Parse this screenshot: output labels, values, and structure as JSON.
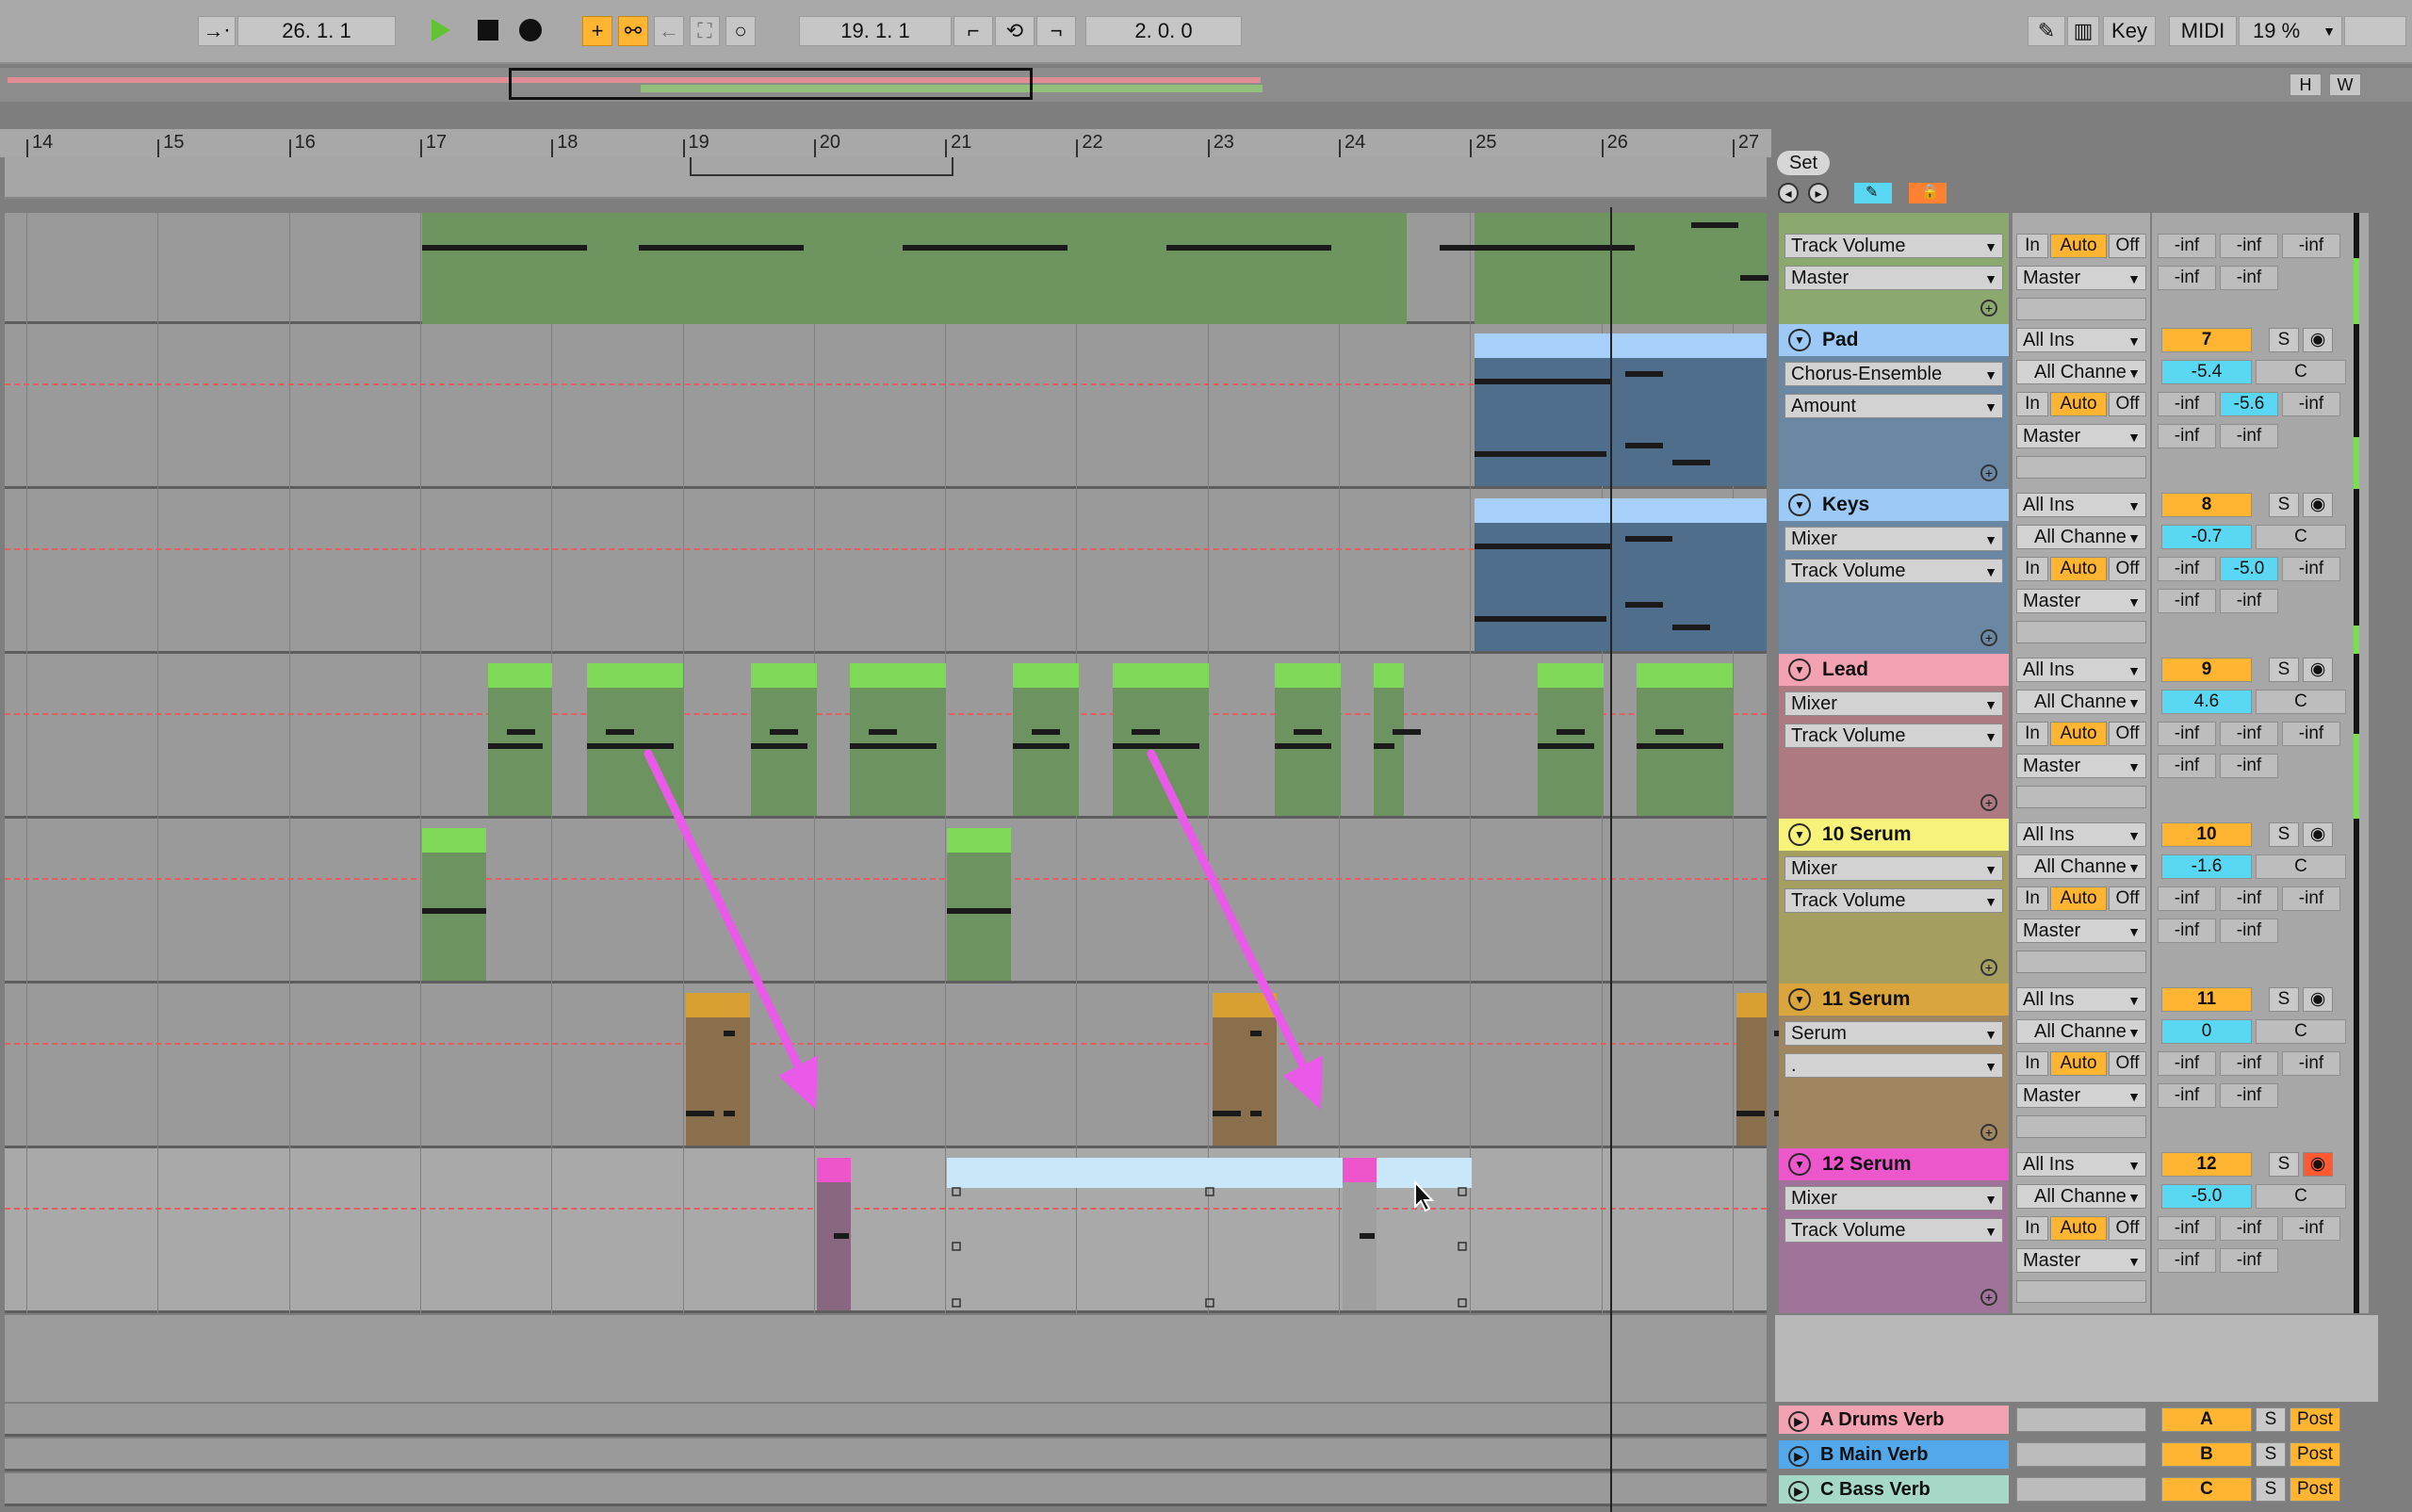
{
  "transport": {
    "follow_glyph": "→⋅",
    "arrangement_position": "26.  1.  1",
    "loop_start": "19.  1.  1",
    "loop_length": "2.  0.  0"
  },
  "right_toolbar": {
    "key_label": "Key",
    "midi_label": "MIDI",
    "zoom": "19 %"
  },
  "overview": {
    "h_label": "H",
    "w_label": "W"
  },
  "ruler": {
    "bars": [
      "14",
      "15",
      "16",
      "17",
      "18",
      "19",
      "20",
      "21",
      "22",
      "23",
      "24",
      "25",
      "26",
      "27"
    ]
  },
  "set_label": "Set",
  "colors": {
    "green_clip": "#75c250",
    "green_clip_top": "#7ed957",
    "blue_clip": "#a6cff9",
    "pink_clip": "#ee55ca",
    "orange_clip": "#d8a032",
    "light_blue": "#c8e8fa",
    "arrow": "#ea5ae8"
  },
  "tracks": [
    {
      "name": "",
      "color": "#7ed957",
      "device": "Track Volume",
      "param": "Master",
      "io": [
        "",
        "",
        ""
      ],
      "number": "",
      "vol": "",
      "pan": "",
      "sends": [
        "-inf",
        "-inf",
        "-inf"
      ],
      "sends2": [
        "-inf",
        "-inf"
      ]
    },
    {
      "name": "Pad",
      "color": "#9cc9f6",
      "device": "Chorus-Ensemble",
      "param": "Amount",
      "input": "All Ins",
      "channel": "All Channe",
      "number": "7",
      "vol": "-5.4",
      "pan": "C",
      "sends": [
        "-inf",
        "-5.6",
        "-inf"
      ],
      "sends2": [
        "-inf",
        "-inf"
      ],
      "out": "Master"
    },
    {
      "name": "Keys",
      "color": "#9cc9f6",
      "device": "Mixer",
      "param": "Track Volume",
      "input": "All Ins",
      "channel": "All Channe",
      "number": "8",
      "vol": "-0.7",
      "pan": "C",
      "sends": [
        "-inf",
        "-5.0",
        "-inf"
      ],
      "sends2": [
        "-inf",
        "-inf"
      ],
      "out": "Master"
    },
    {
      "name": "Lead",
      "color": "#f2a2b0",
      "device": "Mixer",
      "param": "Track Volume",
      "input": "All Ins",
      "channel": "All Channe",
      "number": "9",
      "vol": "4.6",
      "pan": "C",
      "sends": [
        "-inf",
        "-inf",
        "-inf"
      ],
      "sends2": [
        "-inf",
        "-inf"
      ],
      "out": "Master"
    },
    {
      "name": "10 Serum",
      "color": "#f7f27a",
      "device": "Mixer",
      "param": "Track Volume",
      "input": "All Ins",
      "channel": "All Channe",
      "number": "10",
      "vol": "-1.6",
      "pan": "C",
      "sends": [
        "-inf",
        "-inf",
        "-inf"
      ],
      "sends2": [
        "-inf",
        "-inf"
      ],
      "out": "Master"
    },
    {
      "name": "11 Serum",
      "color": "#d9a53c",
      "device": "Serum",
      "param": ".",
      "input": "All Ins",
      "channel": "All Channe",
      "number": "11",
      "vol": "0",
      "pan": "C",
      "sends": [
        "-inf",
        "-inf",
        "-inf"
      ],
      "sends2": [
        "-inf",
        "-inf"
      ],
      "out": "Master"
    },
    {
      "name": "12 Serum",
      "color": "#ec57cc",
      "device": "Mixer",
      "param": "Track Volume",
      "input": "All Ins",
      "channel": "All Channe",
      "number": "12",
      "vol": "-5.0",
      "pan": "C",
      "sends": [
        "-inf",
        "-inf",
        "-inf"
      ],
      "sends2": [
        "-inf",
        "-inf"
      ],
      "out": "Master"
    }
  ],
  "io_labels": {
    "in": "In",
    "auto": "Auto",
    "off": "Off",
    "solo": "S",
    "post": "Post"
  },
  "returns": [
    {
      "name": "A Drums Verb",
      "color": "#f2a2b0",
      "letter": "A"
    },
    {
      "name": "B Main Verb",
      "color": "#53a8ec",
      "letter": "B"
    },
    {
      "name": "C Bass Verb",
      "color": "#a5d8c6",
      "letter": "C"
    }
  ]
}
